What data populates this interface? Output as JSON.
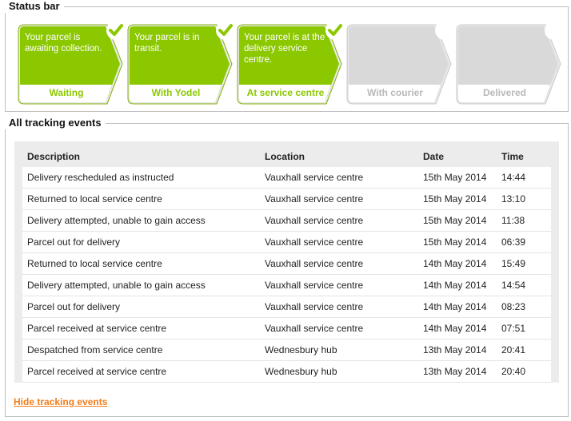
{
  "status_bar": {
    "legend": "Status bar",
    "steps": [
      {
        "label": "Waiting",
        "message": "Your parcel is awaiting collection.",
        "active": true
      },
      {
        "label": "With Yodel",
        "message": "Your parcel is in transit.",
        "active": true
      },
      {
        "label": "At service centre",
        "message": "Your parcel is at the delivery service centre.",
        "active": true
      },
      {
        "label": "With courier",
        "message": "",
        "active": false
      },
      {
        "label": "Delivered",
        "message": "",
        "active": false
      }
    ]
  },
  "events": {
    "legend": "All tracking events",
    "columns": [
      "Description",
      "Location",
      "Date",
      "Time"
    ],
    "rows": [
      [
        "Delivery rescheduled as instructed",
        "Vauxhall service centre",
        "15th May 2014",
        "14:44"
      ],
      [
        "Returned to local service centre",
        "Vauxhall service centre",
        "15th May 2014",
        "13:10"
      ],
      [
        "Delivery attempted, unable to gain access",
        "Vauxhall service centre",
        "15th May 2014",
        "11:38"
      ],
      [
        "Parcel out for delivery",
        "Vauxhall service centre",
        "15th May 2014",
        "06:39"
      ],
      [
        "Returned to local service centre",
        "Vauxhall service centre",
        "14th May 2014",
        "15:49"
      ],
      [
        "Delivery attempted, unable to gain access",
        "Vauxhall service centre",
        "14th May 2014",
        "14:54"
      ],
      [
        "Parcel out for delivery",
        "Vauxhall service centre",
        "14th May 2014",
        "08:23"
      ],
      [
        "Parcel received at service centre",
        "Vauxhall service centre",
        "14th May 2014",
        "07:51"
      ],
      [
        "Despatched from service centre",
        "Wednesbury hub",
        "13th May 2014",
        "20:41"
      ],
      [
        "Parcel received at service centre",
        "Wednesbury hub",
        "13th May 2014",
        "20:40"
      ]
    ],
    "hide_link": "Hide tracking events"
  },
  "colors": {
    "active": "#8cc800",
    "inactive": "#d9d9d9",
    "link": "#f07e1d"
  },
  "icons": {
    "done": "checkmark-icon",
    "pending": "empty-circle-icon"
  }
}
